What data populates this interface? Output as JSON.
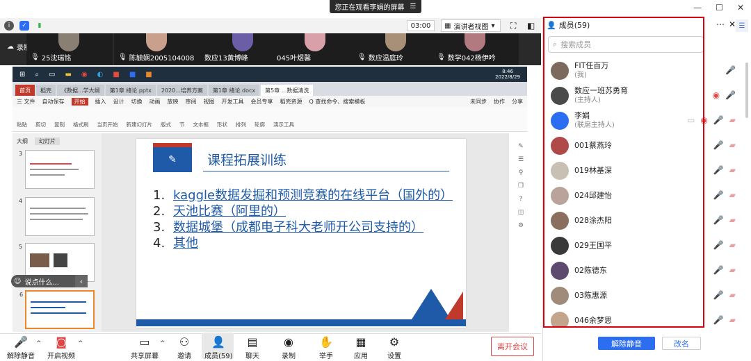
{
  "banner": {
    "text": "您正在观看李娟的屏幕",
    "menu_icon": "menu-icon"
  },
  "window_controls": [
    "—",
    "☐",
    "✕"
  ],
  "topbar": {
    "timer": "03:00",
    "view_mode": "演讲者视图"
  },
  "recording": {
    "label": "录制中"
  },
  "video_strip": [
    {
      "name": "25沈瑞铭"
    },
    {
      "name": "陈毓娴2005104008"
    },
    {
      "name": "数应13黄博峰"
    },
    {
      "name": "045叶煜馨"
    },
    {
      "name": "数应温庭玲"
    },
    {
      "name": "数学042杨伊吟"
    }
  ],
  "windows_taskbar": {
    "time": "8:46",
    "date": "2022/8/29"
  },
  "wps_tabs": [
    {
      "label": "首页"
    },
    {
      "label": "稻壳"
    },
    {
      "label": "《数据...学大纲"
    },
    {
      "label": "第1章 绪论.pptx"
    },
    {
      "label": "2020...培养方案"
    },
    {
      "label": "第1章 绪论.docx"
    },
    {
      "label": "第5章 ...数据清洗"
    }
  ],
  "wps_menu": {
    "file": "三 文件",
    "autosave": "自动保存",
    "items": [
      "开始",
      "插入",
      "设计",
      "切换",
      "动画",
      "放映",
      "审阅",
      "视图",
      "开发工具",
      "会员专享",
      "稻壳资源"
    ],
    "search": "Q 查找命令、搜索模板",
    "right": [
      "未同步",
      "协作",
      "分享"
    ]
  },
  "ribbon": [
    "粘贴",
    "剪切",
    "复制",
    "格式刷",
    "当页开始",
    "新建幻灯片",
    "版式",
    "节",
    "文本框",
    "形状",
    "排列",
    "轮廓",
    "演示工具"
  ],
  "thumbpane": {
    "tabs": [
      "大纲",
      "幻灯片"
    ],
    "slide_numbers": [
      "3",
      "4",
      "5",
      "6"
    ]
  },
  "comment_box": {
    "placeholder": "说点什么..."
  },
  "slide": {
    "title": "课程拓展训练",
    "items": [
      {
        "num": "1.",
        "text": "kaggle数据发掘和预测竞赛的在线平台（国外的）"
      },
      {
        "num": "2.",
        "text": "天池比赛（阿里的）"
      },
      {
        "num": "3.",
        "text": "数据城堡（成都电子科大老师开公司支持的）"
      },
      {
        "num": "4.",
        "text": "其他"
      }
    ]
  },
  "bottom_toolbar": {
    "mute": "解除静音",
    "video": "开启视频",
    "share": "共享屏幕",
    "invite": "邀请",
    "members": "成员(59)",
    "chat": "聊天",
    "record": "录制",
    "raise_hand": "举手",
    "apps": "应用",
    "settings": "设置",
    "leave": "离开会议"
  },
  "panel": {
    "title": "成员(59)",
    "search_placeholder": "搜索成员",
    "unmute_all": "解除静音",
    "rename": "改名",
    "members": [
      {
        "name": "FIT任百万",
        "role": "(我)",
        "status": [
          "mic-off"
        ]
      },
      {
        "name": "数应一班苏勇育",
        "role": "(主持人)",
        "status": [
          "cam-on",
          "mic-off"
        ]
      },
      {
        "name": "李娟",
        "role": "(联席主持人)",
        "status": [
          "screen",
          "cam-on",
          "mic-on",
          "cam-off"
        ]
      },
      {
        "name": "001蔡燕玲",
        "role": "",
        "status": [
          "mic-off",
          "cam-off"
        ]
      },
      {
        "name": "019林基深",
        "role": "",
        "status": [
          "mic-off",
          "cam-off"
        ]
      },
      {
        "name": "024邱建怡",
        "role": "",
        "status": [
          "mic-off",
          "cam-off"
        ]
      },
      {
        "name": "028涂杰阳",
        "role": "",
        "status": [
          "mic-off",
          "cam-off"
        ]
      },
      {
        "name": "029王国平",
        "role": "",
        "status": [
          "mic-off",
          "cam-off"
        ]
      },
      {
        "name": "02陈德东",
        "role": "",
        "status": [
          "mic-off",
          "cam-off"
        ]
      },
      {
        "name": "03陈惠源",
        "role": "",
        "status": [
          "mic-off",
          "cam-off"
        ]
      },
      {
        "name": "046余梦思",
        "role": "",
        "status": [
          "mic-off",
          "cam-off"
        ]
      }
    ]
  }
}
